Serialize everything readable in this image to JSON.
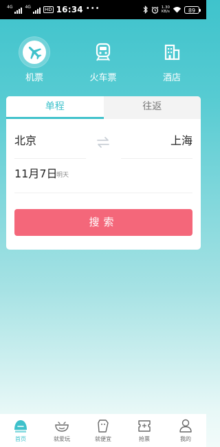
{
  "status_bar": {
    "sig1_label": "4G",
    "sig2_label": "4G",
    "hd_label": "HD",
    "time": "16:34",
    "more": "•••",
    "speed": "1.30\nKB/s",
    "battery": "89"
  },
  "categories": [
    {
      "label": "机票",
      "icon": "airplane-icon"
    },
    {
      "label": "火车票",
      "icon": "train-icon"
    },
    {
      "label": "酒店",
      "icon": "hotel-icon"
    }
  ],
  "tabs": {
    "one_way": "单程",
    "round_trip": "往返"
  },
  "route": {
    "from": "北京",
    "to": "上海"
  },
  "date": {
    "value": "11月7日",
    "sub": "明天"
  },
  "search_label": "搜索",
  "bottom_nav": [
    {
      "label": "首页",
      "icon": "home-icon"
    },
    {
      "label": "就爱玩",
      "icon": "play-icon"
    },
    {
      "label": "就便宜",
      "icon": "cheap-tag-icon"
    },
    {
      "label": "抢票",
      "icon": "ticket-grab-icon"
    },
    {
      "label": "我的",
      "icon": "profile-icon"
    }
  ],
  "colors": {
    "accent": "#3EC1CB",
    "search_button": "#F4677A",
    "bg_top": "#3FC3CC",
    "bg_bottom": "#F2FBFA"
  }
}
